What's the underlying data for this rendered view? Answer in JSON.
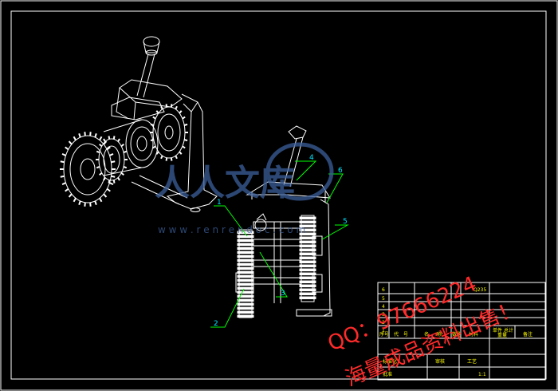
{
  "drawing": {
    "colors": {
      "background": "#000000",
      "frame": "#ffffff",
      "part_lines": "#ffffff",
      "leader": "#00ff00",
      "part_number": "#00e5ff",
      "table": "#ffffff",
      "table_text": "#ffff00",
      "watermark_red": "#ff2a2a",
      "watermark_blue": "#3b5f9a"
    },
    "callouts": [
      {
        "id": "callout-1",
        "number": "1"
      },
      {
        "id": "callout-2",
        "number": "2"
      },
      {
        "id": "callout-3",
        "number": "3"
      },
      {
        "id": "callout-4",
        "number": "4"
      },
      {
        "id": "callout-5",
        "number": "5"
      },
      {
        "id": "callout-6",
        "number": "6"
      }
    ],
    "parts_table": {
      "row_numbers": [
        "6",
        "5",
        "4",
        "3",
        "2",
        "1"
      ],
      "top_right_code": "Q235",
      "header_cells": [
        "序号",
        "代",
        "号",
        "名",
        "称",
        "数",
        "量",
        "材料",
        "单件",
        "总计",
        "备注",
        "重量"
      ],
      "bottom_cells": [
        "标准化",
        "审核",
        "工艺",
        "批准",
        "1:1"
      ]
    },
    "watermarks": {
      "site_name": "人人文库",
      "site_url": "w w w . r e n r e n d o c . c o m",
      "qq": "QQ：97666224",
      "sale_text": "海量成品资料出售！"
    }
  }
}
